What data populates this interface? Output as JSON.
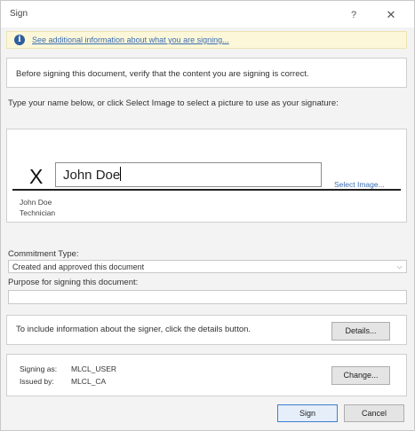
{
  "window": {
    "title": "Sign",
    "help_glyph": "?",
    "close_glyph": "✕"
  },
  "infobar": {
    "icon": "info-icon",
    "link_text": "See additional information about what you are signing..."
  },
  "verify": {
    "text": "Before signing this document, verify that the content you are signing is correct."
  },
  "instructions": {
    "text": "Type your name below, or click Select Image to select a picture to use as your signature:"
  },
  "signature": {
    "x_mark": "X",
    "name_value": "John Doe",
    "select_image_label": "Select Image...",
    "signer_name": "John Doe",
    "signer_title": "Technician"
  },
  "commitment": {
    "label": "Commitment Type:",
    "selected": "Created and approved this document"
  },
  "purpose": {
    "label": "Purpose for signing this document:",
    "value": ""
  },
  "details": {
    "text": "To include information about the signer, click the details button.",
    "button_label": "Details..."
  },
  "signing_info": {
    "signing_as_label": "Signing as:",
    "signing_as_value": "MLCL_USER",
    "issued_by_label": "Issued by:",
    "issued_by_value": "MLCL_CA",
    "change_button_label": "Change..."
  },
  "footer": {
    "sign_label": "Sign",
    "cancel_label": "Cancel"
  }
}
